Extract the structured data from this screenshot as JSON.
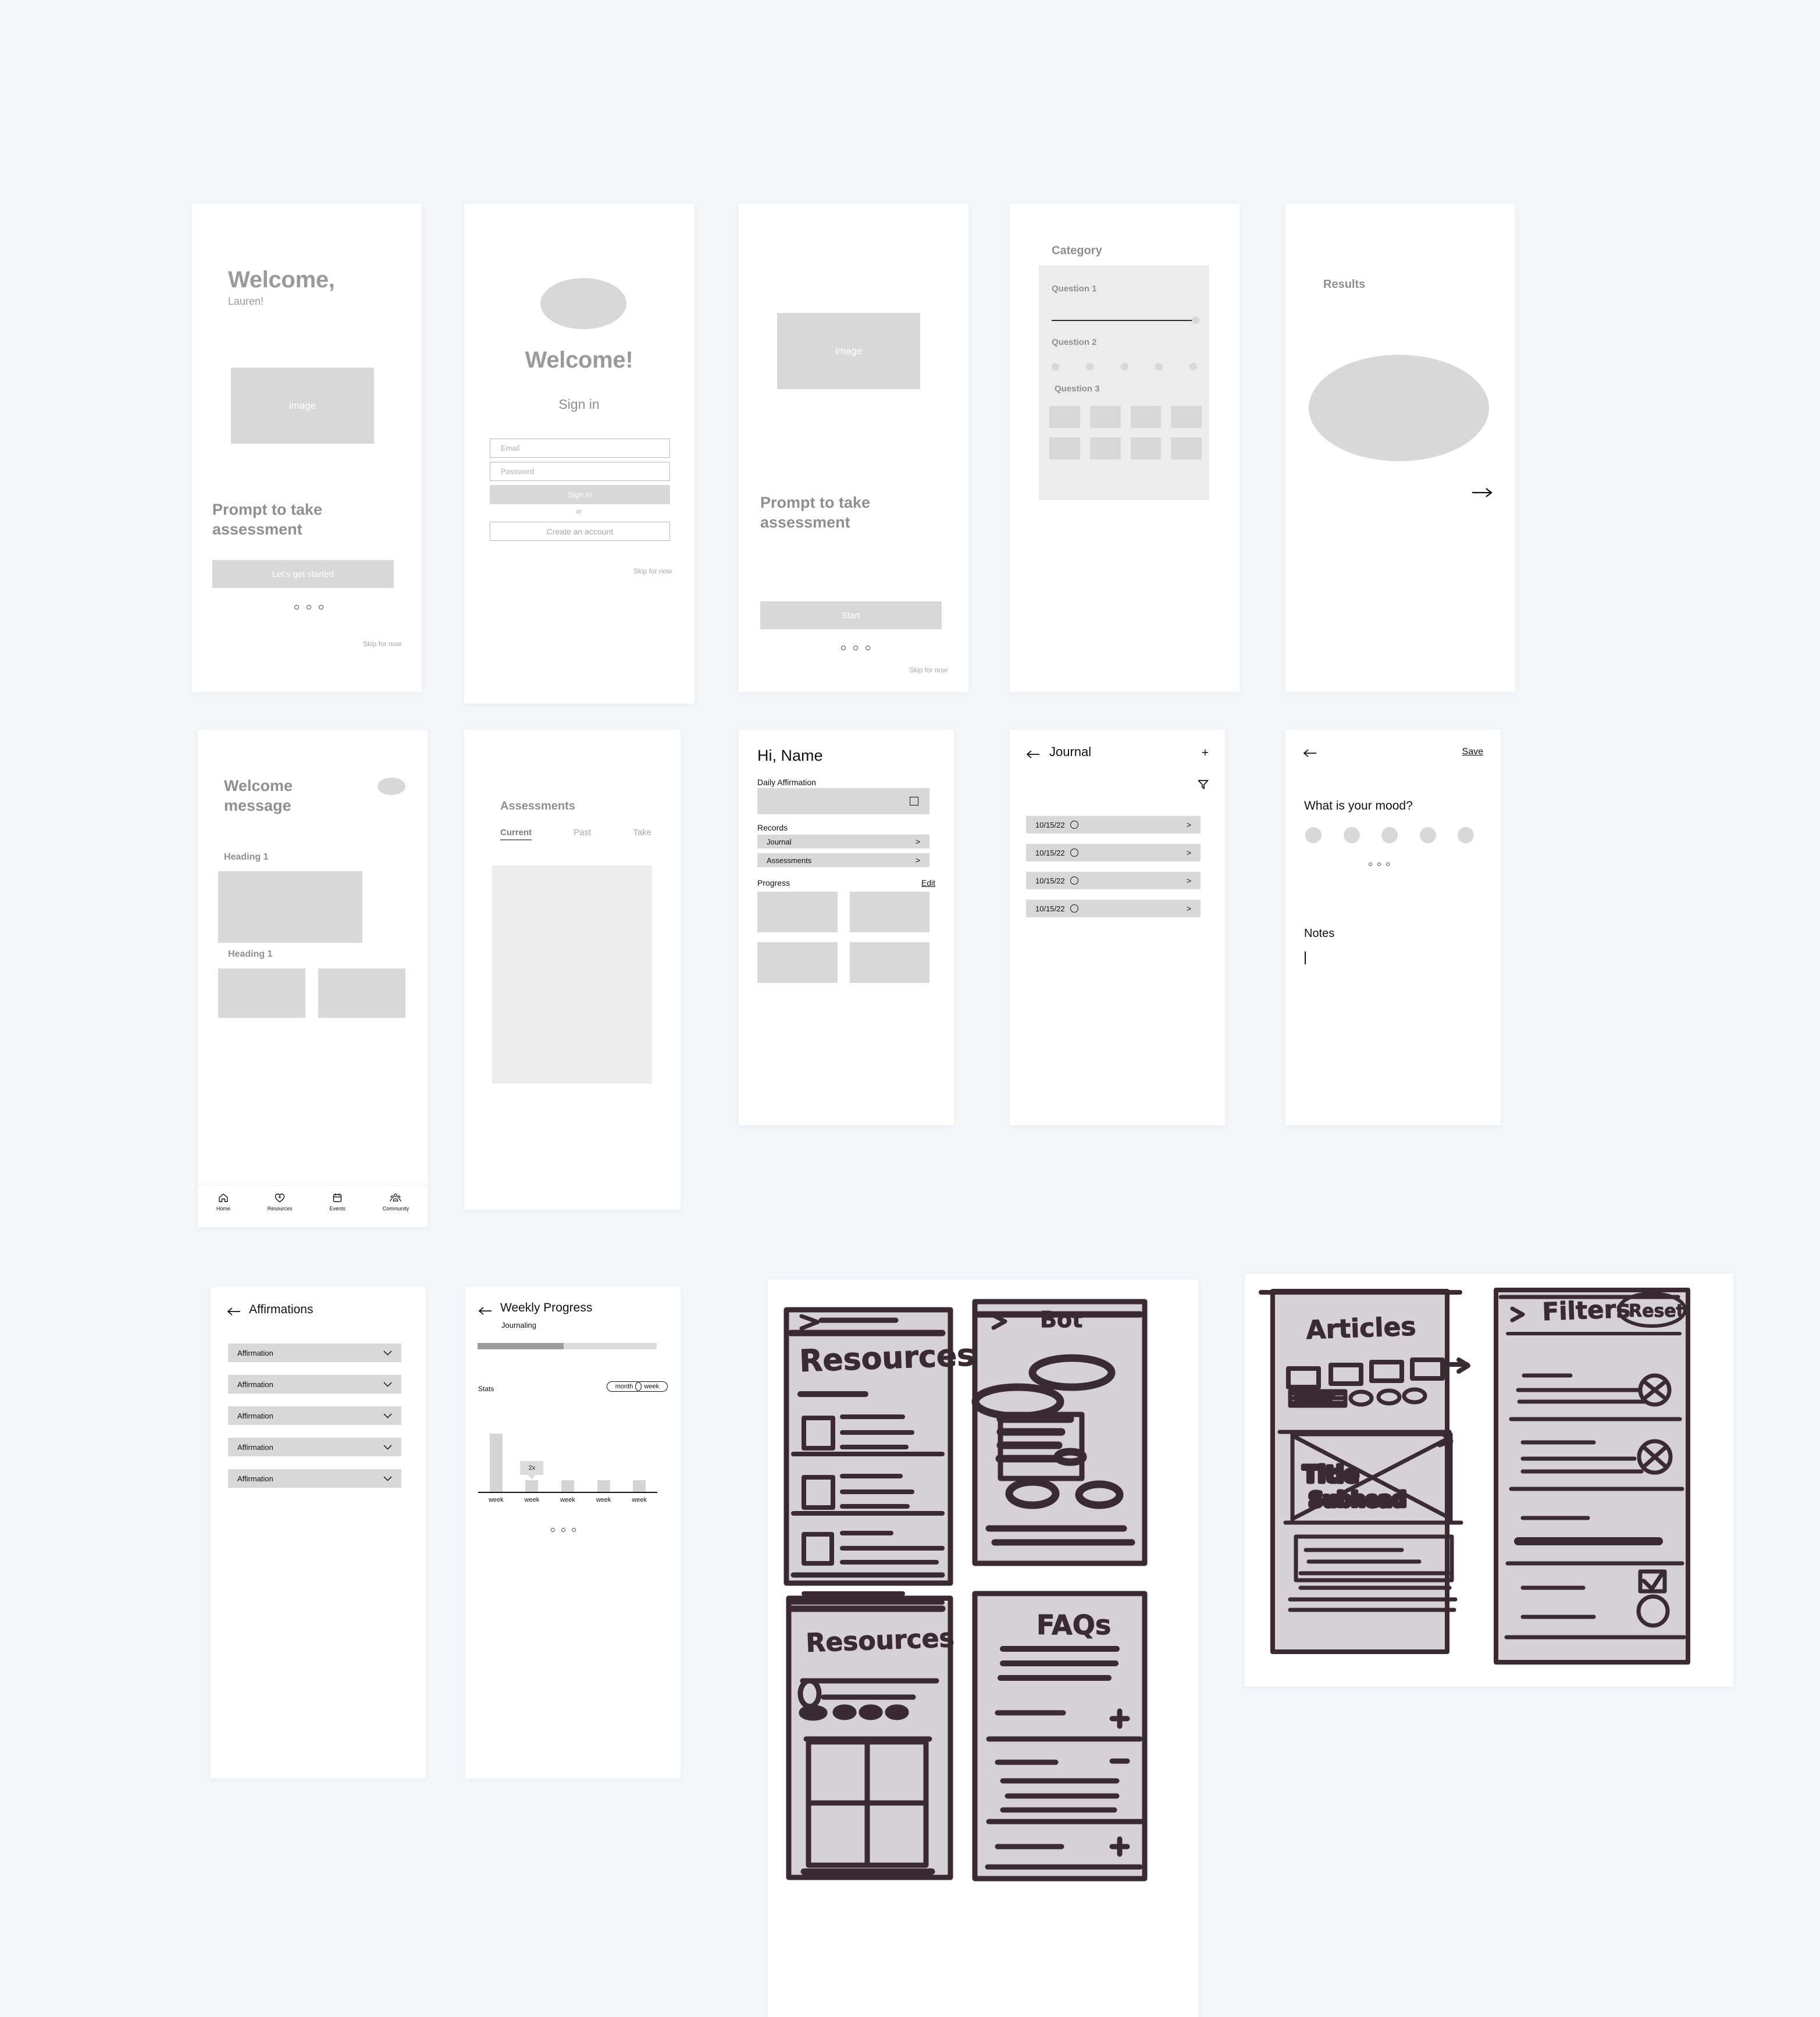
{
  "board": {
    "background_color": "#f4f6fa",
    "placeholder_color": "#d8d8d8"
  },
  "screens": {
    "welcome_onboarding": {
      "title": "Welcome,",
      "subtitle": "Lauren!",
      "image_caption": "image",
      "prompt": "Prompt to take assessment",
      "cta": "Let's get started",
      "skip": "Skip for now",
      "pager_dots": 3
    },
    "sign_in": {
      "title": "Welcome!",
      "subtitle": "Sign in",
      "email_placeholder": "Email",
      "password_placeholder": "Password",
      "primary_button": "Sign In",
      "divider": "or",
      "secondary_button": "Create an account",
      "skip": "Skip for now"
    },
    "assessment_intro": {
      "image_caption": "image",
      "prompt": "Prompt to take assessment",
      "cta": "Start",
      "skip": "Skip for now",
      "pager_dots": 3
    },
    "category_questions": {
      "title": "Category",
      "questions": [
        {
          "label": "Question 1",
          "type": "slider"
        },
        {
          "label": "Question 2",
          "type": "scale-dots",
          "options": 5
        },
        {
          "label": "Question 3",
          "type": "image-grid",
          "rows": 2,
          "cols": 4
        }
      ]
    },
    "results": {
      "title": "Results",
      "next_icon": "arrow-right-icon"
    },
    "home_feed": {
      "title": "Welcome message",
      "avatar": "avatar",
      "sections": [
        {
          "heading": "Heading 1",
          "layout": "single"
        },
        {
          "heading": "Heading 1",
          "layout": "double"
        }
      ],
      "bottom_nav": [
        {
          "label": "Home",
          "icon": "home-icon"
        },
        {
          "label": "Resources",
          "icon": "heart-plus-icon"
        },
        {
          "label": "Events",
          "icon": "calendar-icon"
        },
        {
          "label": "Community",
          "icon": "people-icon"
        }
      ]
    },
    "assessments": {
      "title": "Assessments",
      "tabs": [
        {
          "label": "Current",
          "active": true
        },
        {
          "label": "Past",
          "active": false
        },
        {
          "label": "Take",
          "active": false
        }
      ]
    },
    "dashboard": {
      "greeting": "Hi, Name",
      "affirmation_label": "Daily Affirmation",
      "affirmation_checkbox": "checkbox-icon",
      "records_label": "Records",
      "records": [
        {
          "label": "Journal",
          "chevron": ">"
        },
        {
          "label": "Assessments",
          "chevron": ">"
        }
      ],
      "progress_label": "Progress",
      "edit_label": "Edit",
      "progress_tiles": 4
    },
    "journal": {
      "back_icon": "arrow-left-icon",
      "title": "Journal",
      "add_label": "+",
      "filter_icon": "filter-icon",
      "entries": [
        {
          "date": "10/15/22",
          "mood": "mood-circle",
          "chevron": ">"
        },
        {
          "date": "10/15/22",
          "mood": "mood-circle",
          "chevron": ">"
        },
        {
          "date": "10/15/22",
          "mood": "mood-circle",
          "chevron": ">"
        },
        {
          "date": "10/15/22",
          "mood": "mood-circle",
          "chevron": ">"
        }
      ]
    },
    "mood_entry": {
      "back_icon": "arrow-left-icon",
      "save_label": "Save",
      "question": "What is your mood?",
      "mood_options": 5,
      "pager_dots": 3,
      "notes_label": "Notes",
      "notes_value": ""
    },
    "affirmations": {
      "back_icon": "arrow-left-icon",
      "title": "Affirmations",
      "items": [
        {
          "label": "Affirmation",
          "chevron": "chevron-down-icon"
        },
        {
          "label": "Affirmation",
          "chevron": "chevron-down-icon"
        },
        {
          "label": "Affirmation",
          "chevron": "chevron-down-icon"
        },
        {
          "label": "Affirmation",
          "chevron": "chevron-down-icon"
        },
        {
          "label": "Affirmation",
          "chevron": "chevron-down-icon"
        }
      ]
    },
    "weekly_progress": {
      "back_icon": "arrow-left-icon",
      "title": "Weekly Progress",
      "subtitle": "Journaling",
      "progress_percent": 48,
      "stats_label": "Stats",
      "toggle": [
        {
          "label": "month",
          "active": true
        },
        {
          "label": "week",
          "active": false
        }
      ],
      "pager_dots": 3
    }
  },
  "chart_data": {
    "type": "bar",
    "title": "Weekly Progress",
    "subtitle": "Journaling",
    "categories": [
      "week",
      "week",
      "week",
      "week",
      "week"
    ],
    "values": [
      10,
      2,
      2,
      2,
      2
    ],
    "ylim": [
      0,
      10
    ],
    "annotation": {
      "label": "2x",
      "at_category_index": 1
    },
    "xlabel": "",
    "ylabel": "",
    "grid": false,
    "legend": "none"
  },
  "sketches": {
    "sketch_left": {
      "panels": [
        {
          "label": "Resources",
          "position": "top-left",
          "back_icon": "arrow-left-icon",
          "kind": "list"
        },
        {
          "label": "Bot",
          "position": "top-right",
          "back_icon": "arrow-left-icon",
          "kind": "chat"
        },
        {
          "label": "Resources",
          "position": "bottom-left",
          "kind": "grid"
        },
        {
          "label": "FAQs",
          "position": "bottom-right",
          "kind": "accordion"
        }
      ]
    },
    "sketch_right": {
      "panels": [
        {
          "label": "Articles",
          "position": "left",
          "kind": "cards",
          "annotations": [
            "Filter",
            "Title",
            "Subhead"
          ]
        },
        {
          "label": "Filters",
          "position": "right",
          "kind": "filter-list",
          "annotations": [
            "Reset"
          ],
          "back_icon": "arrow-left-icon"
        }
      ]
    }
  }
}
